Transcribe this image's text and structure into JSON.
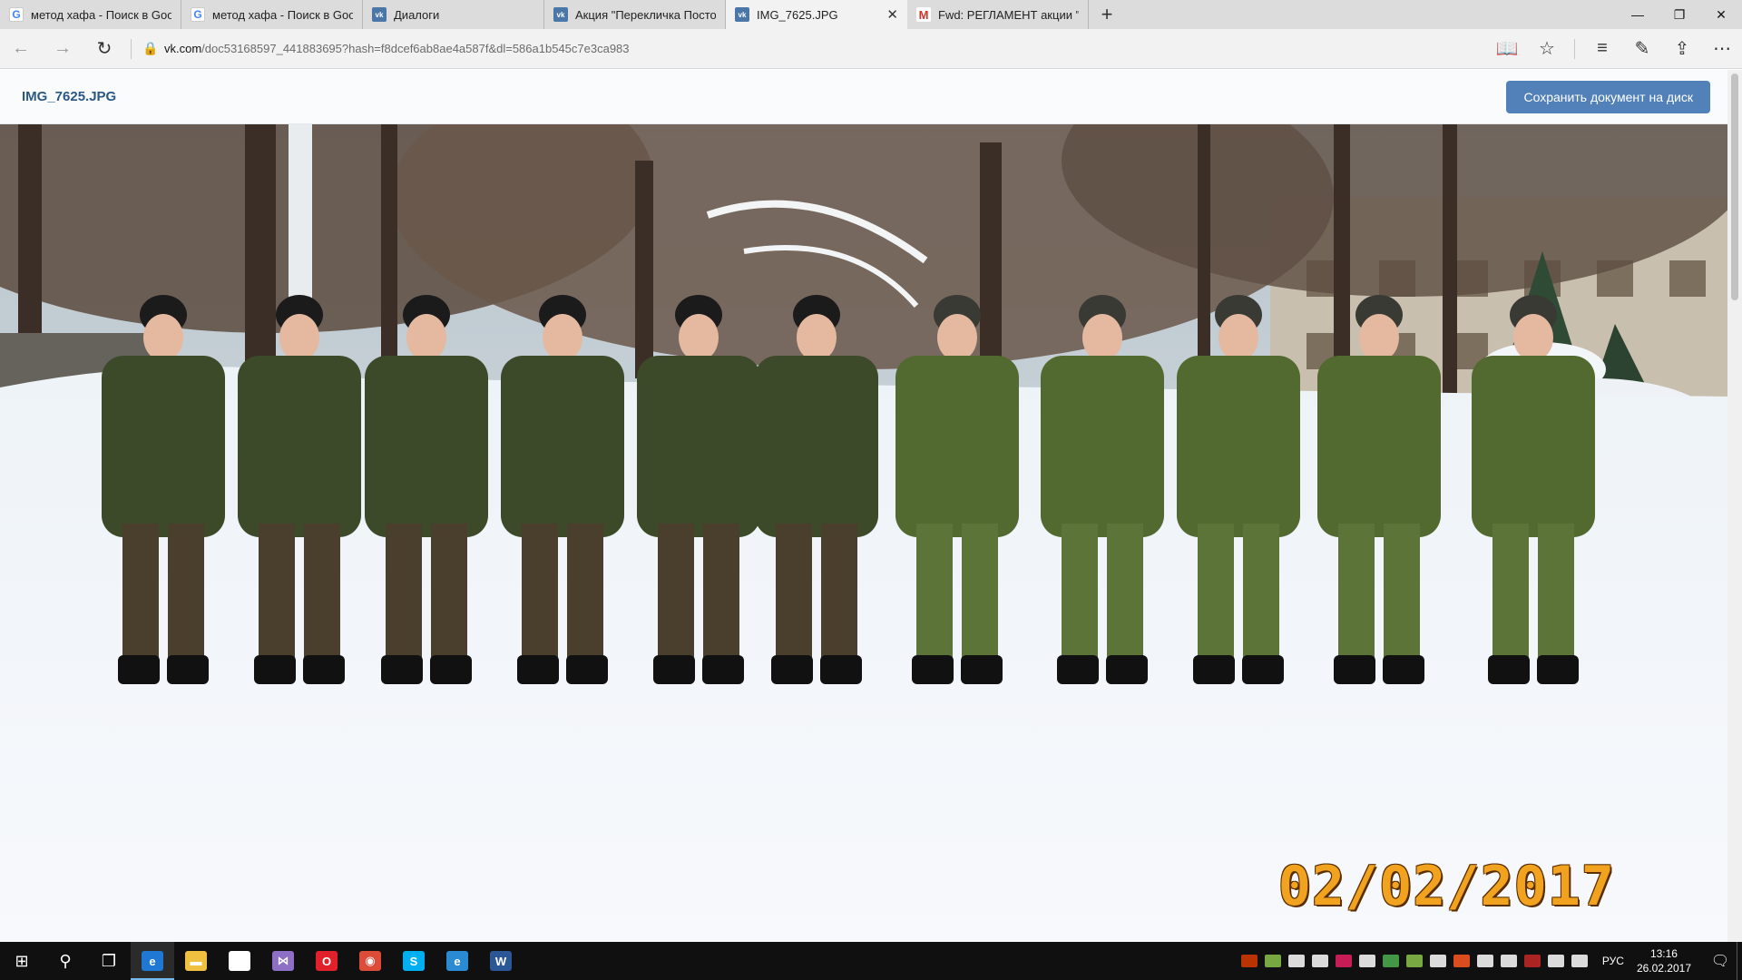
{
  "tabs": [
    {
      "title": "метод хафа - Поиск в Goog",
      "favicon": "google-icon",
      "active": false
    },
    {
      "title": "метод хафа - Поиск в Goog",
      "favicon": "google-icon",
      "active": false
    },
    {
      "title": "Диалоги",
      "favicon": "vk-icon",
      "active": false
    },
    {
      "title": "Акция \"Перекличка Посто",
      "favicon": "vk-icon",
      "active": false
    },
    {
      "title": "IMG_7625.JPG",
      "favicon": "vk-icon",
      "active": true,
      "close": "✕"
    },
    {
      "title": "Fwd: РЕГЛАМЕНТ акции \"П",
      "favicon": "gmail-icon",
      "active": false
    }
  ],
  "newtab": "+",
  "window": {
    "minimize": "—",
    "restore": "❐",
    "close": "✕"
  },
  "address": {
    "host": "vk.com",
    "path": "/doc53168597_441883695?hash=f8dcef6ab8ae4a587f&dl=586a1b545c7e3ca983"
  },
  "nav": {
    "back": "←",
    "forward": "→",
    "refresh": "↻",
    "lock": "🔒"
  },
  "toolbar": {
    "reading": "📖",
    "favorite": "☆",
    "hub": "≡",
    "notes": "✎",
    "share": "⇪",
    "more": "⋯"
  },
  "document": {
    "name": "IMG_7625.JPG",
    "save_label": "Сохранить документ на диск",
    "date_stamp": "02/02/2017"
  },
  "taskbar": {
    "start": "⊞",
    "search": "⚲",
    "taskview": "❐",
    "apps": [
      {
        "name": "edge-icon",
        "glyph": "e",
        "color": "#1e78d4",
        "active": true
      },
      {
        "name": "file-explorer-icon",
        "glyph": "▬",
        "color": "#f0c040",
        "active": false
      },
      {
        "name": "store-icon",
        "glyph": "🛍",
        "color": "#ffffff",
        "active": false
      },
      {
        "name": "visual-studio-icon",
        "glyph": "⋈",
        "color": "#8e6fc6",
        "active": false
      },
      {
        "name": "opera-icon",
        "glyph": "O",
        "color": "#e0202a",
        "active": false
      },
      {
        "name": "chrome-icon",
        "glyph": "◉",
        "color": "#dd4b39",
        "active": false
      },
      {
        "name": "skype-icon",
        "glyph": "S",
        "color": "#00aff0",
        "active": false
      },
      {
        "name": "internet-explorer-icon",
        "glyph": "e",
        "color": "#2a8ad4",
        "active": false
      },
      {
        "name": "word-icon",
        "glyph": "W",
        "color": "#2b5797",
        "active": false
      }
    ],
    "tray_colors": [
      "#d83b01",
      "#8bc34a",
      "#ffffff",
      "#ffffff",
      "#e91e63",
      "#ffffff",
      "#4caf50",
      "#8bc34a",
      "#ffffff",
      "#ff5722",
      "#ffffff",
      "#ffffff",
      "#c62828",
      "#ffffff",
      "#ffffff"
    ],
    "language": "РУС",
    "time": "13:16",
    "date": "26.02.2017",
    "notifications": "🗨"
  }
}
